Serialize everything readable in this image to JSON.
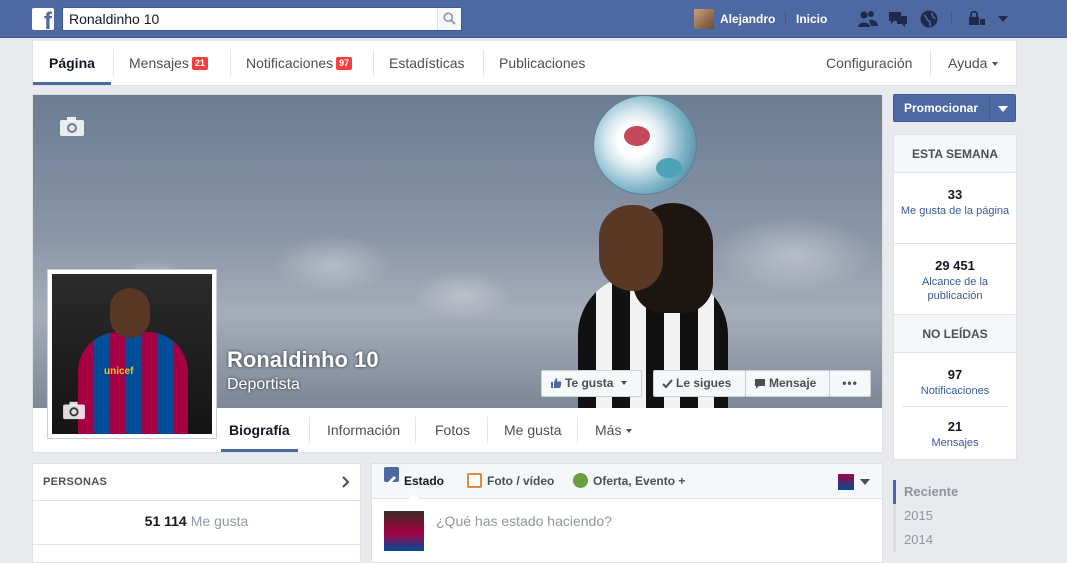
{
  "topbar": {
    "search_value": "Ronaldinho 10",
    "user_name": "Alejandro",
    "home_label": "Inicio"
  },
  "pagenav": {
    "tabs": [
      {
        "label": "Página",
        "badge": ""
      },
      {
        "label": "Mensajes",
        "badge": "21"
      },
      {
        "label": "Notificaciones",
        "badge": "97"
      },
      {
        "label": "Estadísticas",
        "badge": ""
      },
      {
        "label": "Publicaciones",
        "badge": ""
      }
    ],
    "config_label": "Configuración",
    "help_label": "Ayuda"
  },
  "cover": {
    "page_name": "Ronaldinho 10",
    "category": "Deportista",
    "like_button": "Te gusta",
    "follow_button": "Le sigues",
    "message_button": "Mensaje",
    "more_button": "•••",
    "jersey_text": "unicef"
  },
  "tabs": [
    "Biografía",
    "Información",
    "Fotos",
    "Me gusta",
    "Más"
  ],
  "promote": {
    "label": "Promocionar"
  },
  "stats": {
    "week_title": "ESTA SEMANA",
    "likes_value": "33",
    "likes_label": "Me gusta de la página",
    "reach_value": "29 451",
    "reach_label": "Alcance de la publicación",
    "unread_title": "NO LEÍDAS",
    "notif_value": "97",
    "notif_label": "Notificaciones",
    "msg_value": "21",
    "msg_label": "Mensajes"
  },
  "timeline": [
    "Reciente",
    "2015",
    "2014"
  ],
  "people": {
    "title": "PERSONAS",
    "likes_count": "51 114",
    "likes_label": "Me gusta"
  },
  "composer": {
    "tab_status": "Estado",
    "tab_photo": "Foto / vídeo",
    "tab_offer": "Oferta, Evento +",
    "placeholder": "¿Qué has estado haciendo?"
  },
  "colors": {
    "brand_blue": "#4e69a2",
    "badge_red": "#fa3e3e",
    "link_blue": "#3b5998"
  }
}
